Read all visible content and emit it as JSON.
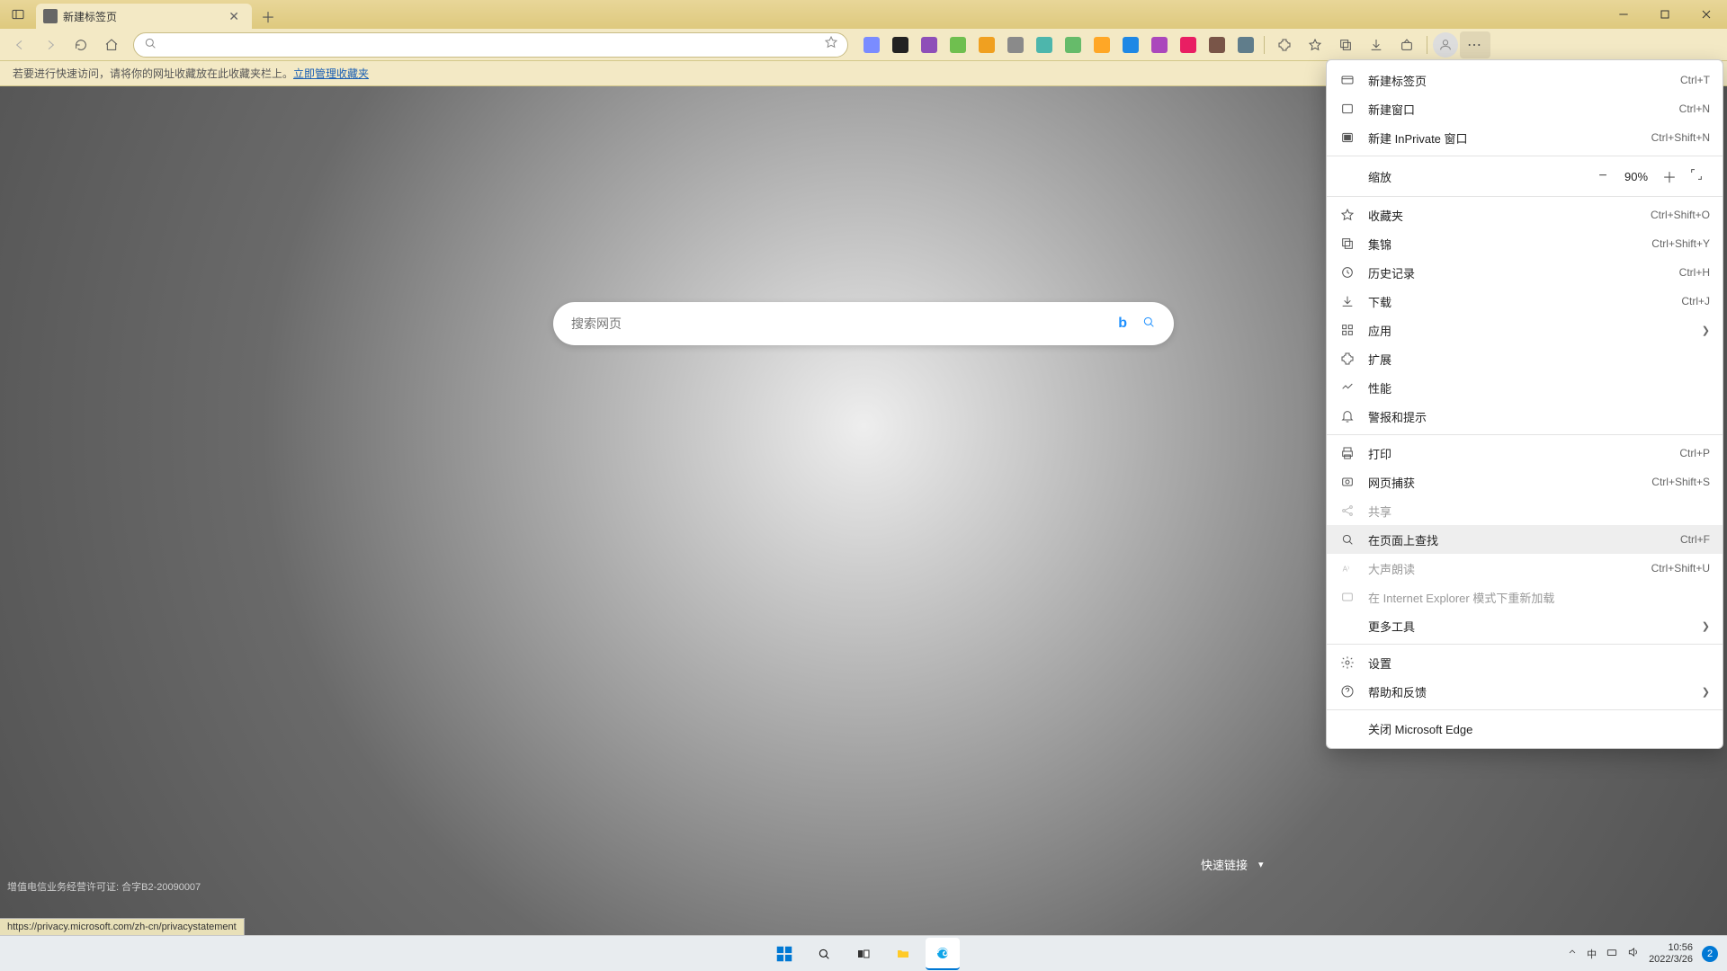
{
  "tab": {
    "title": "新建标签页"
  },
  "window": {
    "minimize": "—",
    "maximize": "▢",
    "close": "✕"
  },
  "toolbar": {
    "favorite_place": "☆"
  },
  "info_bar": {
    "text": "若要进行快速访问，请将你的网址收藏放在此收藏夹栏上。",
    "link": "立即管理收藏夹"
  },
  "search": {
    "placeholder": "搜索网页",
    "bing": "b"
  },
  "quick_links": {
    "label": "快速链接"
  },
  "license_text": "增值电信业务经营许可证: 合字B2-20090007",
  "hover_url": "https://privacy.microsoft.com/zh-cn/privacystatement",
  "menu": {
    "new_tab": {
      "label": "新建标签页",
      "shortcut": "Ctrl+T"
    },
    "new_window": {
      "label": "新建窗口",
      "shortcut": "Ctrl+N"
    },
    "new_inprivate": {
      "label": "新建 InPrivate 窗口",
      "shortcut": "Ctrl+Shift+N"
    },
    "zoom": {
      "label": "缩放",
      "value": "90%"
    },
    "favorites": {
      "label": "收藏夹",
      "shortcut": "Ctrl+Shift+O"
    },
    "collections": {
      "label": "集锦",
      "shortcut": "Ctrl+Shift+Y"
    },
    "history": {
      "label": "历史记录",
      "shortcut": "Ctrl+H"
    },
    "downloads": {
      "label": "下载",
      "shortcut": "Ctrl+J"
    },
    "apps": {
      "label": "应用"
    },
    "extensions": {
      "label": "扩展"
    },
    "performance": {
      "label": "性能"
    },
    "alerts": {
      "label": "警报和提示"
    },
    "print": {
      "label": "打印",
      "shortcut": "Ctrl+P"
    },
    "capture": {
      "label": "网页捕获",
      "shortcut": "Ctrl+Shift+S"
    },
    "share": {
      "label": "共享"
    },
    "find": {
      "label": "在页面上查找",
      "shortcut": "Ctrl+F"
    },
    "read_aloud": {
      "label": "大声朗读",
      "shortcut": "Ctrl+Shift+U"
    },
    "ie_mode": {
      "label": "在 Internet Explorer 模式下重新加载"
    },
    "more_tools": {
      "label": "更多工具"
    },
    "settings": {
      "label": "设置"
    },
    "help": {
      "label": "帮助和反馈"
    },
    "close_edge": {
      "label": "关闭 Microsoft Edge"
    }
  },
  "ext_colors": [
    "#7a8cff",
    "#222222",
    "#8e4fb8",
    "#6fbf4f",
    "#f0a020",
    "#8a8a8a",
    "#4db6ac",
    "#66bb6a",
    "#ffa726",
    "#1e88e5",
    "#ab47bc",
    "#e91e63",
    "#795548",
    "#607d8b"
  ],
  "systray": {
    "ime": "中",
    "time": "10:56",
    "date": "2022/3/26",
    "notif_count": "2"
  }
}
